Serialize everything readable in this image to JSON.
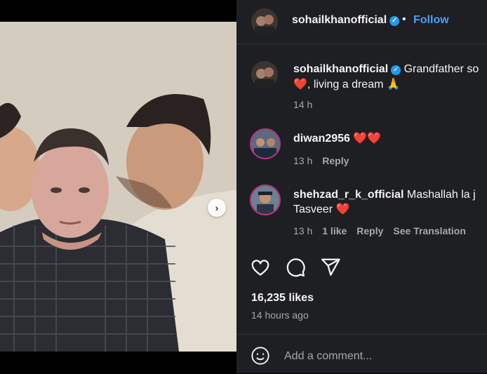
{
  "post": {
    "username": "sohailkhanofficial",
    "follow_label": "Follow",
    "separator": "•"
  },
  "caption": {
    "username": "sohailkhanofficial",
    "line1": "Grandfather so",
    "line2": ", living a dream",
    "time": "14 h"
  },
  "comments": [
    {
      "username": "diwan2956",
      "text": "",
      "time": "13 h",
      "reply": "Reply"
    },
    {
      "username": "shehzad_r_k_official",
      "text": "Mashallah la j",
      "text2": "Tasveer",
      "time": "13 h",
      "likes": "1 like",
      "reply": "Reply",
      "translate": "See Translation"
    }
  ],
  "likes": "16,235 likes",
  "posted": "14 hours ago",
  "add_comment_placeholder": "Add a comment...",
  "colors": {
    "accent": "#4a9eff",
    "verified": "#1d9bf0",
    "heart": "#ed4956"
  },
  "icons": [
    "heart-icon",
    "comment-icon",
    "share-icon",
    "emoji-icon",
    "chevron-right-icon"
  ]
}
